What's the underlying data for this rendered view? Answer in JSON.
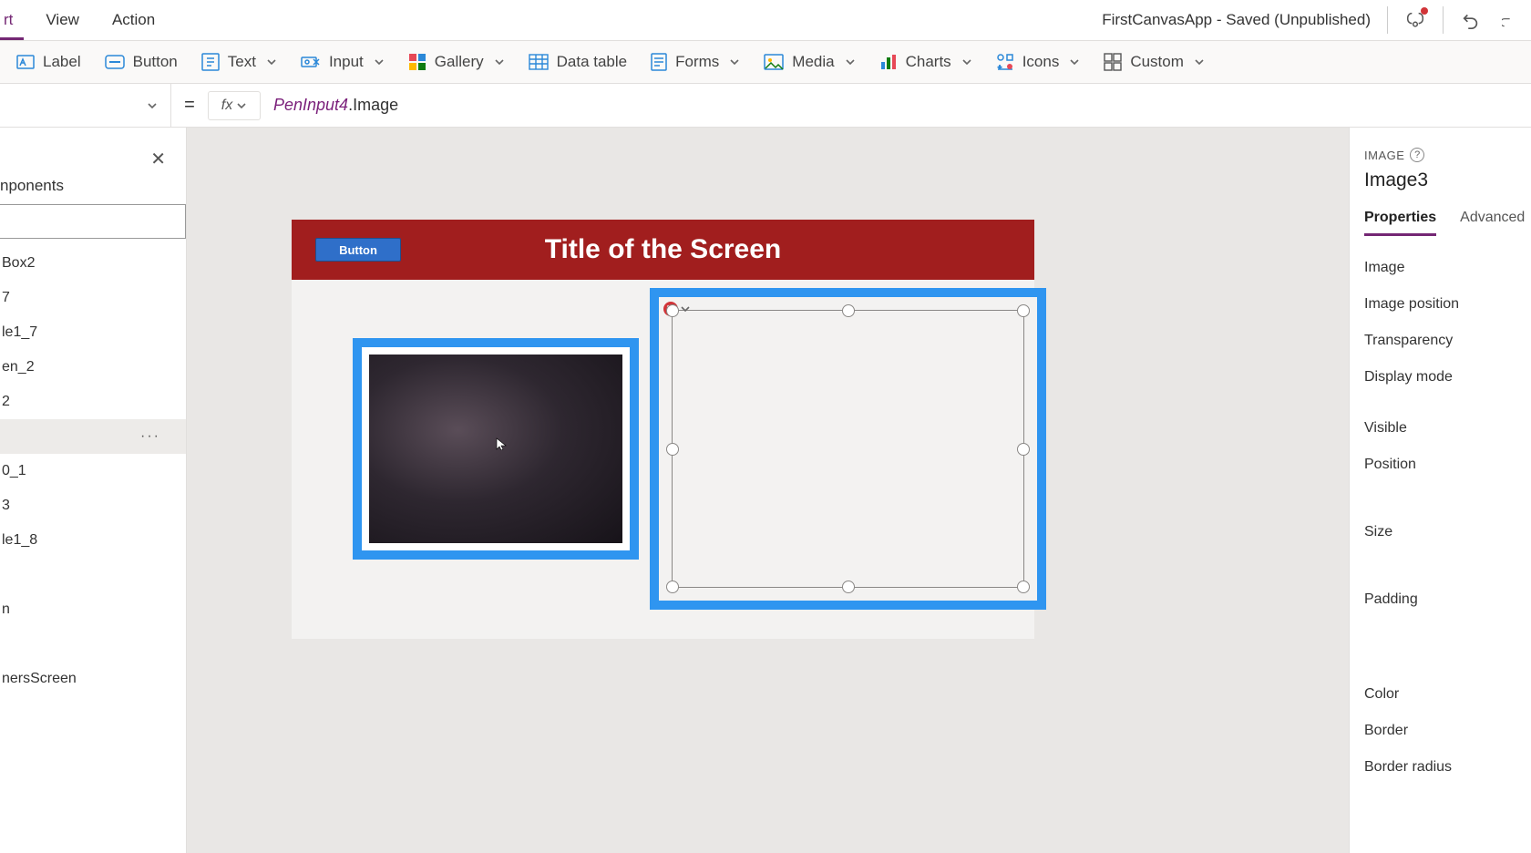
{
  "menu": {
    "tabs": [
      "rt",
      "View",
      "Action"
    ],
    "active": 0,
    "saveStatus": "FirstCanvasApp - Saved (Unpublished)"
  },
  "ribbon": {
    "label": "Label",
    "button": "Button",
    "text": "Text",
    "input": "Input",
    "gallery": "Gallery",
    "datatable": "Data table",
    "forms": "Forms",
    "media": "Media",
    "charts": "Charts",
    "icons": "Icons",
    "custom": "Custom"
  },
  "fbar": {
    "eq": "=",
    "fx": "fx",
    "formula_obj": "PenInput4",
    "formula_prop": ".Image"
  },
  "tree": {
    "heading": "nponents",
    "items": [
      "Box2",
      "7",
      "le1_7",
      "en_2",
      "2",
      "",
      "0_1",
      "3",
      "le1_8",
      "",
      "n",
      "",
      "nersScreen"
    ],
    "selectedIndex": 5
  },
  "canvas": {
    "title": "Title of the Screen",
    "button": "Button"
  },
  "panel": {
    "type": "IMAGE",
    "name": "Image3",
    "tabs": [
      "Properties",
      "Advanced"
    ],
    "activeTab": 0,
    "props1": [
      "Image",
      "Image position",
      "Transparency",
      "Display mode"
    ],
    "props2": [
      "Visible",
      "Position",
      "Size",
      "Padding"
    ],
    "props3": [
      "Color",
      "Border",
      "Border radius"
    ]
  }
}
